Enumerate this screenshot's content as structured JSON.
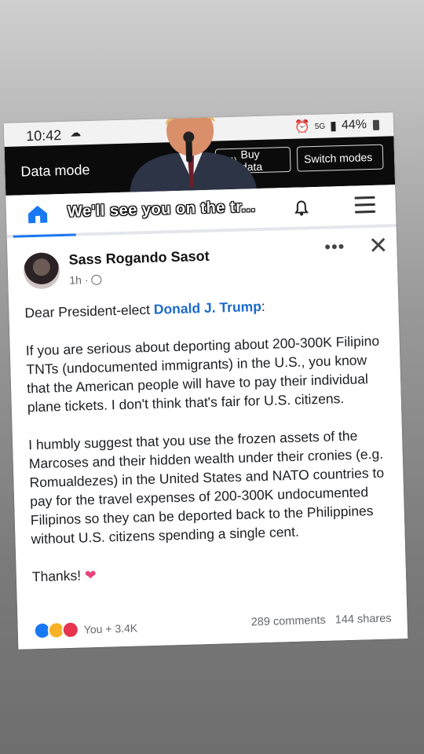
{
  "status_bar": {
    "time": "10:42",
    "network": "5G",
    "battery": "44%"
  },
  "data_mode": {
    "title": "Data mode",
    "buy_label": "Buy data",
    "switch_label": "Switch modes"
  },
  "overlay": {
    "caption": "We'll see you on the tr..."
  },
  "post": {
    "author": "Sass Rogando Sasot",
    "time": "1h ·",
    "greeting_prefix": "Dear President-elect ",
    "mention": "Donald J. Trump",
    "greeting_suffix": ":",
    "paragraph1": "If you are serious about deporting about 200-300K Filipino TNTs (undocumented immigrants) in the U.S., you know that the American people will have to pay their individual plane tickets. I don't think that's fair for U.S. citizens.",
    "paragraph2": "I humbly suggest that you use the frozen assets of the Marcoses and their hidden wealth under their cronies (e.g. Romualdezes) in the United States and NATO countries to pay for the travel expenses of 200-300K undocumented Filipinos so they can be deported back to the Philippines without U.S. citizens spending a single cent.",
    "closing": "Thanks!",
    "closing_emoji": "❤",
    "reactions_text": "You + 3.4K",
    "comments": "289 comments",
    "shares": "144 shares"
  },
  "colors": {
    "accent": "#1877f2",
    "mention": "#1b6ac9",
    "heart": "#e8437a"
  }
}
